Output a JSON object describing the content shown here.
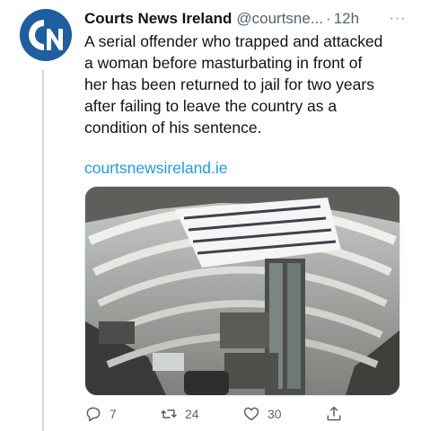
{
  "tweet": {
    "display_name": "Courts News Ireland",
    "handle": "@courtsne...",
    "separator": "·",
    "time": "12h",
    "more_label": "···",
    "text_lines": [
      "A serial offender who trapped and attacked",
      "a woman before masturbating in front of",
      "her has been returned to jail for two years",
      "after failing to leave the country as a",
      "condition of his sentence."
    ],
    "link": "courtsnewsireland.ie",
    "avatar_initials": "CN"
  },
  "actions": {
    "reply_count": "7",
    "retweet_count": "24",
    "like_count": "30"
  },
  "icons": {
    "avatar": "courts-news-ireland-logo",
    "more": "more-horizontal-icon",
    "reply": "reply-icon",
    "retweet": "retweet-icon",
    "like": "heart-icon",
    "share": "share-icon"
  },
  "colors": {
    "text": "#0f1419",
    "secondary": "#536471",
    "link": "#1d9bf0",
    "avatar_blue": "#1f5ea0"
  }
}
